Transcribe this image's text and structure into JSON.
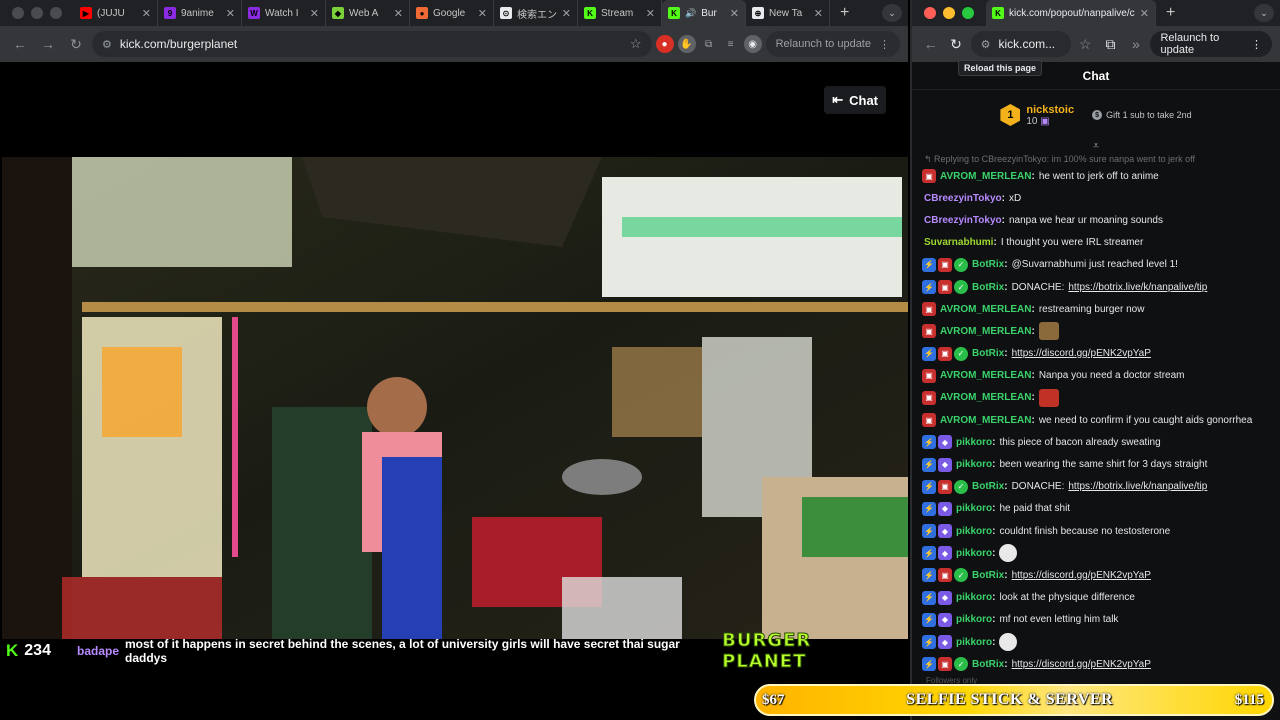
{
  "left_window": {
    "tabs": [
      {
        "title": "(JUJU",
        "fav_color": "#ff0000",
        "fav_glyph": "▶"
      },
      {
        "title": "9anime",
        "fav_color": "#8a2be2",
        "fav_glyph": "9"
      },
      {
        "title": "Watch I",
        "fav_color": "#8a2be2",
        "fav_glyph": "W"
      },
      {
        "title": "Web A",
        "fav_color": "#7cd13a",
        "fav_glyph": "◆"
      },
      {
        "title": "Google",
        "fav_color": "#f06a35",
        "fav_glyph": "●"
      },
      {
        "title": "検索エン",
        "fav_color": "#e8eaed",
        "fav_glyph": "⊙"
      },
      {
        "title": "Stream",
        "fav_color": "#53fc18",
        "fav_glyph": "K"
      },
      {
        "title": "Bur",
        "fav_color": "#53fc18",
        "fav_glyph": "K",
        "active": true
      },
      {
        "title": "New Ta",
        "fav_color": "#e8eaed",
        "fav_glyph": "⊕"
      }
    ],
    "url": "kick.com/burgerplanet",
    "relaunch_label": "Relaunch to update"
  },
  "right_window": {
    "tab_title": "kick.com/popout/nanpalive/c",
    "url": "kick.com...",
    "relaunch_label": "Relaunch to update",
    "tooltip": "Reload this page"
  },
  "stream": {
    "chat_toggle_label": "Chat",
    "viewer_count": "234",
    "overlay_user": "badape",
    "overlay_message": "most of it happens in secret behind the scenes, a lot of university girls will have secret thai sugar daddys",
    "brand_logo_text": "BURGER PLANET"
  },
  "chat": {
    "header": "Chat",
    "top_gifter": {
      "rank": "1",
      "name": "nickstoic",
      "count": "10",
      "tip": "Gift 1 sub to take 2nd"
    },
    "reply_to": "Replying to CBreezyinTokyo: im 100% sure nanpa went to jerk off",
    "messages": [
      {
        "badges": [
          "red"
        ],
        "user": "AVROM_MERLEAN",
        "color": "#3ad36b",
        "text": "he went to jerk off to anime"
      },
      {
        "badges": [],
        "user": "CBreezyinTokyo",
        "color": "#b78aff",
        "text": "xD"
      },
      {
        "badges": [],
        "user": "CBreezyinTokyo",
        "color": "#b78aff",
        "text": "nanpa we hear ur moaning sounds"
      },
      {
        "badges": [],
        "user": "Suvarnabhumi",
        "color": "#9ed92f",
        "text": "I thought you were IRL streamer"
      },
      {
        "badges": [
          "blue",
          "red",
          "green"
        ],
        "user": "BotRix",
        "color": "#3ad36b",
        "text": "@Suvarnabhumi just reached level 1!"
      },
      {
        "badges": [
          "blue",
          "red",
          "green"
        ],
        "user": "BotRix",
        "color": "#3ad36b",
        "text": "DONACHE: ",
        "link": "https://botrix.live/k/nanpalive/tip"
      },
      {
        "badges": [
          "red"
        ],
        "user": "AVROM_MERLEAN",
        "color": "#3ad36b",
        "text": "restreaming burger now"
      },
      {
        "badges": [
          "red"
        ],
        "user": "AVROM_MERLEAN",
        "color": "#3ad36b",
        "text": "",
        "emote": "brown"
      },
      {
        "badges": [
          "blue",
          "red",
          "green"
        ],
        "user": "BotRix",
        "color": "#3ad36b",
        "text": "",
        "link": "https://discord.gg/pENK2vpYaP"
      },
      {
        "badges": [
          "red"
        ],
        "user": "AVROM_MERLEAN",
        "color": "#3ad36b",
        "text": "Nanpa you need a doctor stream"
      },
      {
        "badges": [
          "red"
        ],
        "user": "AVROM_MERLEAN",
        "color": "#3ad36b",
        "text": "",
        "emote": "red"
      },
      {
        "badges": [
          "red"
        ],
        "user": "AVROM_MERLEAN",
        "color": "#3ad36b",
        "text": "we need to confirm if you caught aids gonorrhea"
      },
      {
        "badges": [
          "blue",
          "purple"
        ],
        "user": "pikkoro",
        "color": "#3ad36b",
        "text": "this piece of bacon already sweating"
      },
      {
        "badges": [
          "blue",
          "purple"
        ],
        "user": "pikkoro",
        "color": "#3ad36b",
        "text": "been wearing the same shirt for 3 days straight"
      },
      {
        "badges": [
          "blue",
          "red",
          "green"
        ],
        "user": "BotRix",
        "color": "#3ad36b",
        "text": "DONACHE: ",
        "link": "https://botrix.live/k/nanpalive/tip"
      },
      {
        "badges": [
          "blue",
          "purple"
        ],
        "user": "pikkoro",
        "color": "#3ad36b",
        "text": "he paid that shit"
      },
      {
        "badges": [
          "blue",
          "purple"
        ],
        "user": "pikkoro",
        "color": "#3ad36b",
        "text": "couldnt finish because no testosterone"
      },
      {
        "badges": [
          "blue",
          "purple"
        ],
        "user": "pikkoro",
        "color": "#3ad36b",
        "text": "",
        "emote": "white"
      },
      {
        "badges": [
          "blue",
          "red",
          "green"
        ],
        "user": "BotRix",
        "color": "#3ad36b",
        "text": "",
        "link": "https://discord.gg/pENK2vpYaP"
      },
      {
        "badges": [
          "blue",
          "purple"
        ],
        "user": "pikkoro",
        "color": "#3ad36b",
        "text": "look at the physique difference"
      },
      {
        "badges": [
          "blue",
          "purple"
        ],
        "user": "pikkoro",
        "color": "#3ad36b",
        "text": "mf not even letting him talk"
      },
      {
        "badges": [
          "blue",
          "purple"
        ],
        "user": "pikkoro",
        "color": "#3ad36b",
        "text": "",
        "emote": "white"
      },
      {
        "badges": [
          "blue",
          "red",
          "green"
        ],
        "user": "BotRix",
        "color": "#3ad36b",
        "text": "",
        "link": "https://discord.gg/pENK2vpYaP"
      }
    ],
    "followers_only": "Followers only"
  },
  "goal": {
    "current": "$67",
    "title": "SELFIE STICK & SERVER",
    "target": "$115"
  }
}
